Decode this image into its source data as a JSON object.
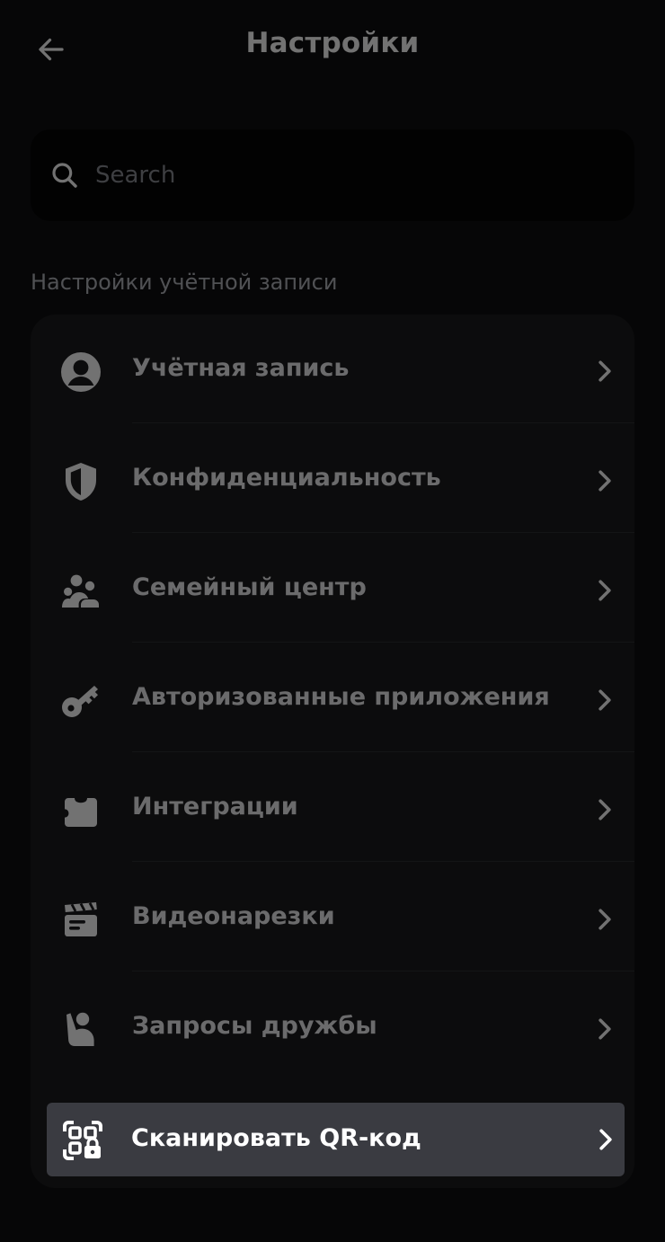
{
  "header": {
    "title": "Настройки",
    "back_icon": "arrow-left-icon"
  },
  "search": {
    "placeholder": "Search",
    "value": ""
  },
  "section": {
    "title": "Настройки учётной записи"
  },
  "menu": {
    "items": [
      {
        "label": "Учётная запись",
        "icon": "user-circle-icon"
      },
      {
        "label": "Конфиденциальность",
        "icon": "shield-icon"
      },
      {
        "label": "Семейный центр",
        "icon": "family-icon"
      },
      {
        "label": "Авторизованные приложения",
        "icon": "key-icon"
      },
      {
        "label": "Интеграции",
        "icon": "puzzle-icon"
      },
      {
        "label": "Видеонарезки",
        "icon": "clapperboard-icon"
      },
      {
        "label": "Запросы дружбы",
        "icon": "friend-wave-icon"
      },
      {
        "label": "Сканировать QR-код",
        "icon": "qr-scan-icon",
        "selected": true
      }
    ]
  },
  "colors": {
    "background": "#0f0f11",
    "card": "#1c1c1f",
    "search_bg": "#050506",
    "selected_row": "#3a3b41",
    "text_primary": "#f0f0f2",
    "text_secondary": "#b3b5bb"
  }
}
